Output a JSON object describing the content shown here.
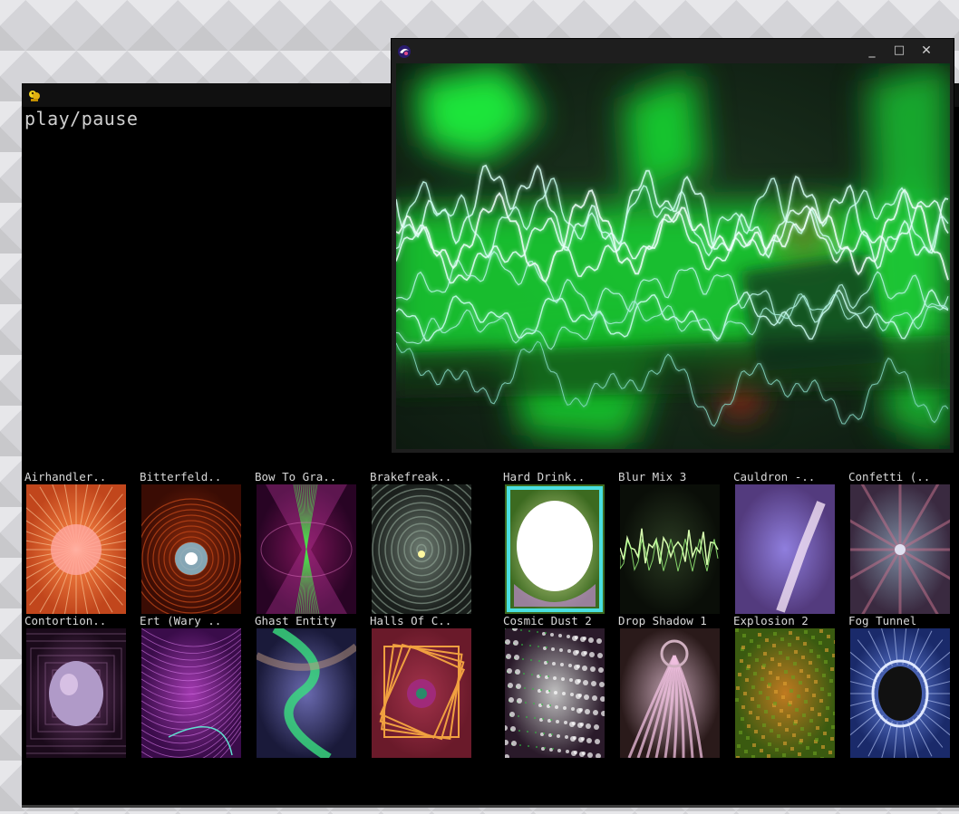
{
  "controller_window": {
    "play_pause_label": "play/pause",
    "presets_row1": [
      {
        "label": "Airhandler..",
        "thumb": "sunburst-orange"
      },
      {
        "label": "Bitterfeld..",
        "thumb": "red-vortex"
      },
      {
        "label": "Bow To Gra..",
        "thumb": "magenta-hourglass"
      },
      {
        "label": "Brakefreak..",
        "thumb": "grey-tunnel"
      },
      {
        "label": "Hard Drink..",
        "thumb": "white-blob"
      },
      {
        "label": "Blur Mix 3",
        "thumb": "green-waveform"
      },
      {
        "label": "Cauldron -..",
        "thumb": "blue-spark"
      },
      {
        "label": "Confetti (..",
        "thumb": "kaleidoscope"
      }
    ],
    "presets_row2": [
      {
        "label": "Contortion..",
        "thumb": "sphere-tunnel"
      },
      {
        "label": "Ert (Wary ..",
        "thumb": "purple-mesh"
      },
      {
        "label": "Ghast Entity",
        "thumb": "swirl-green"
      },
      {
        "label": "Halls Of C..",
        "thumb": "orange-squares"
      },
      {
        "label": "Cosmic Dust 2",
        "thumb": "green-dust"
      },
      {
        "label": "Drop Shadow 1",
        "thumb": "pink-swirl"
      },
      {
        "label": "Explosion 2",
        "thumb": "autumn-noise"
      },
      {
        "label": "Fog Tunnel",
        "thumb": "blue-ring"
      }
    ]
  },
  "visualizer_window": {
    "minimize_label": "_",
    "maximize_label": "□",
    "close_label": "✕"
  },
  "colors": {
    "window_bg": "#000000",
    "viz_green": "#19e62e",
    "wave_cyan": "#bffcf0"
  }
}
